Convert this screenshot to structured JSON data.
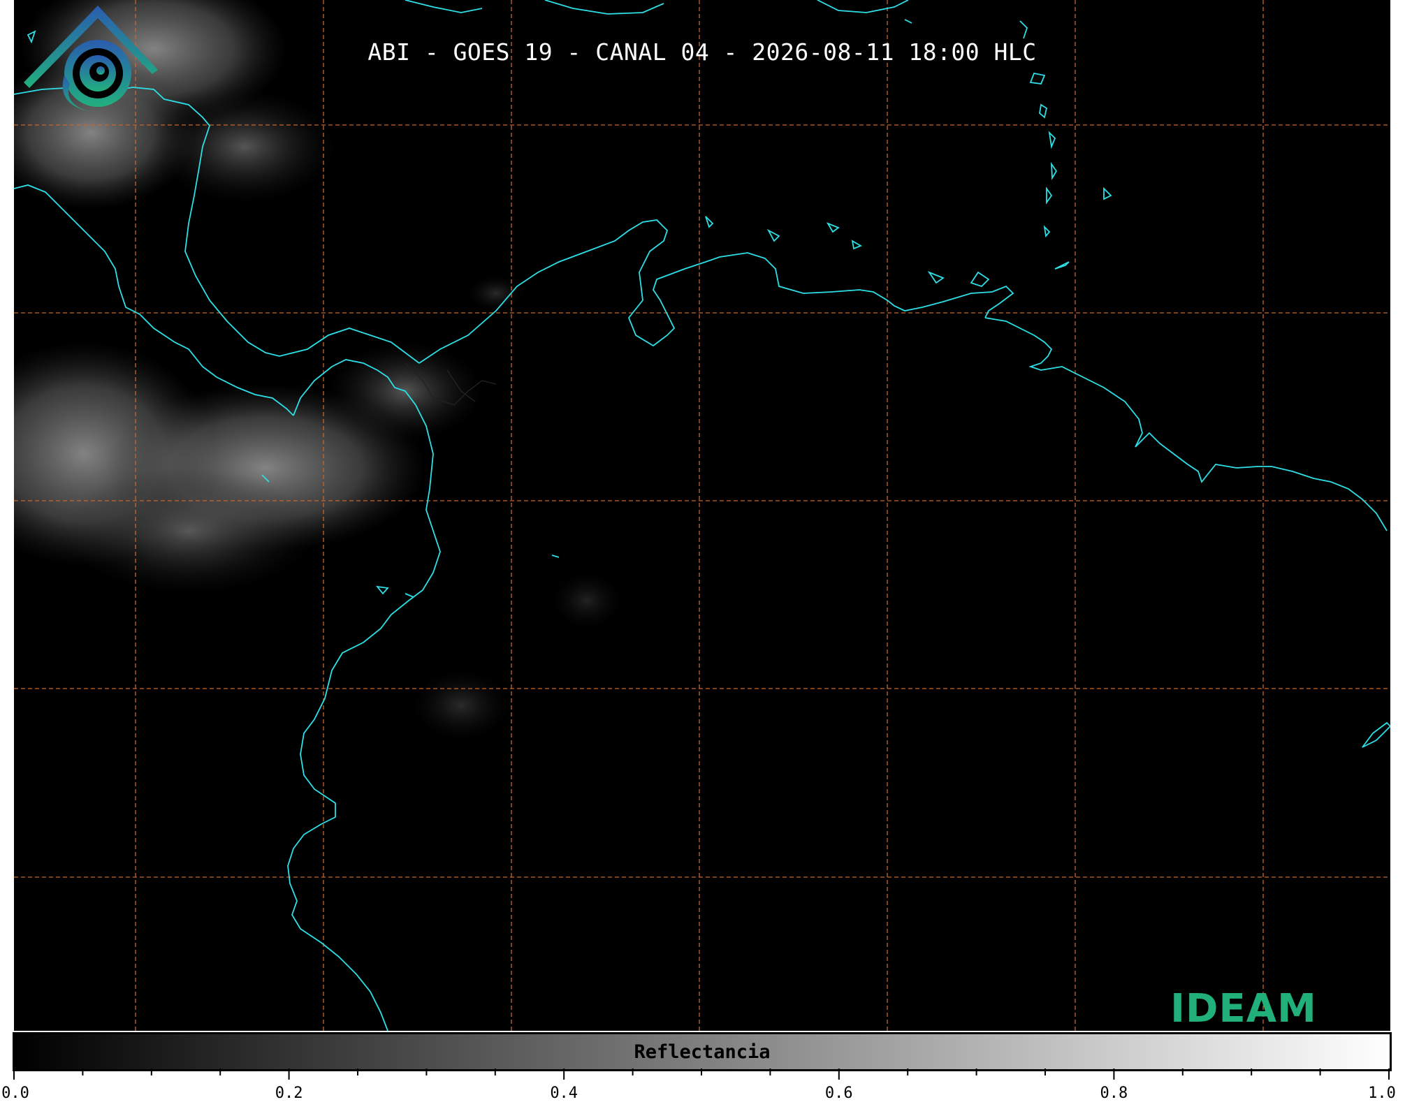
{
  "title": "ABI - GOES 19 - CANAL 04 - 2026-08-11 18:00 HLC",
  "colorbar": {
    "label": "Reflectancia",
    "ticks": [
      "0.0",
      "0.2",
      "0.4",
      "0.6",
      "0.8",
      "1.0"
    ],
    "range": [
      0.0,
      1.0
    ],
    "colormap": "grayscale black-to-white"
  },
  "logo": {
    "text": "IDEAM"
  },
  "colors": {
    "coastline": "#2de0e8",
    "gridline": "#c8662a",
    "background": "#000000",
    "logo_text": "#22b07a"
  }
}
